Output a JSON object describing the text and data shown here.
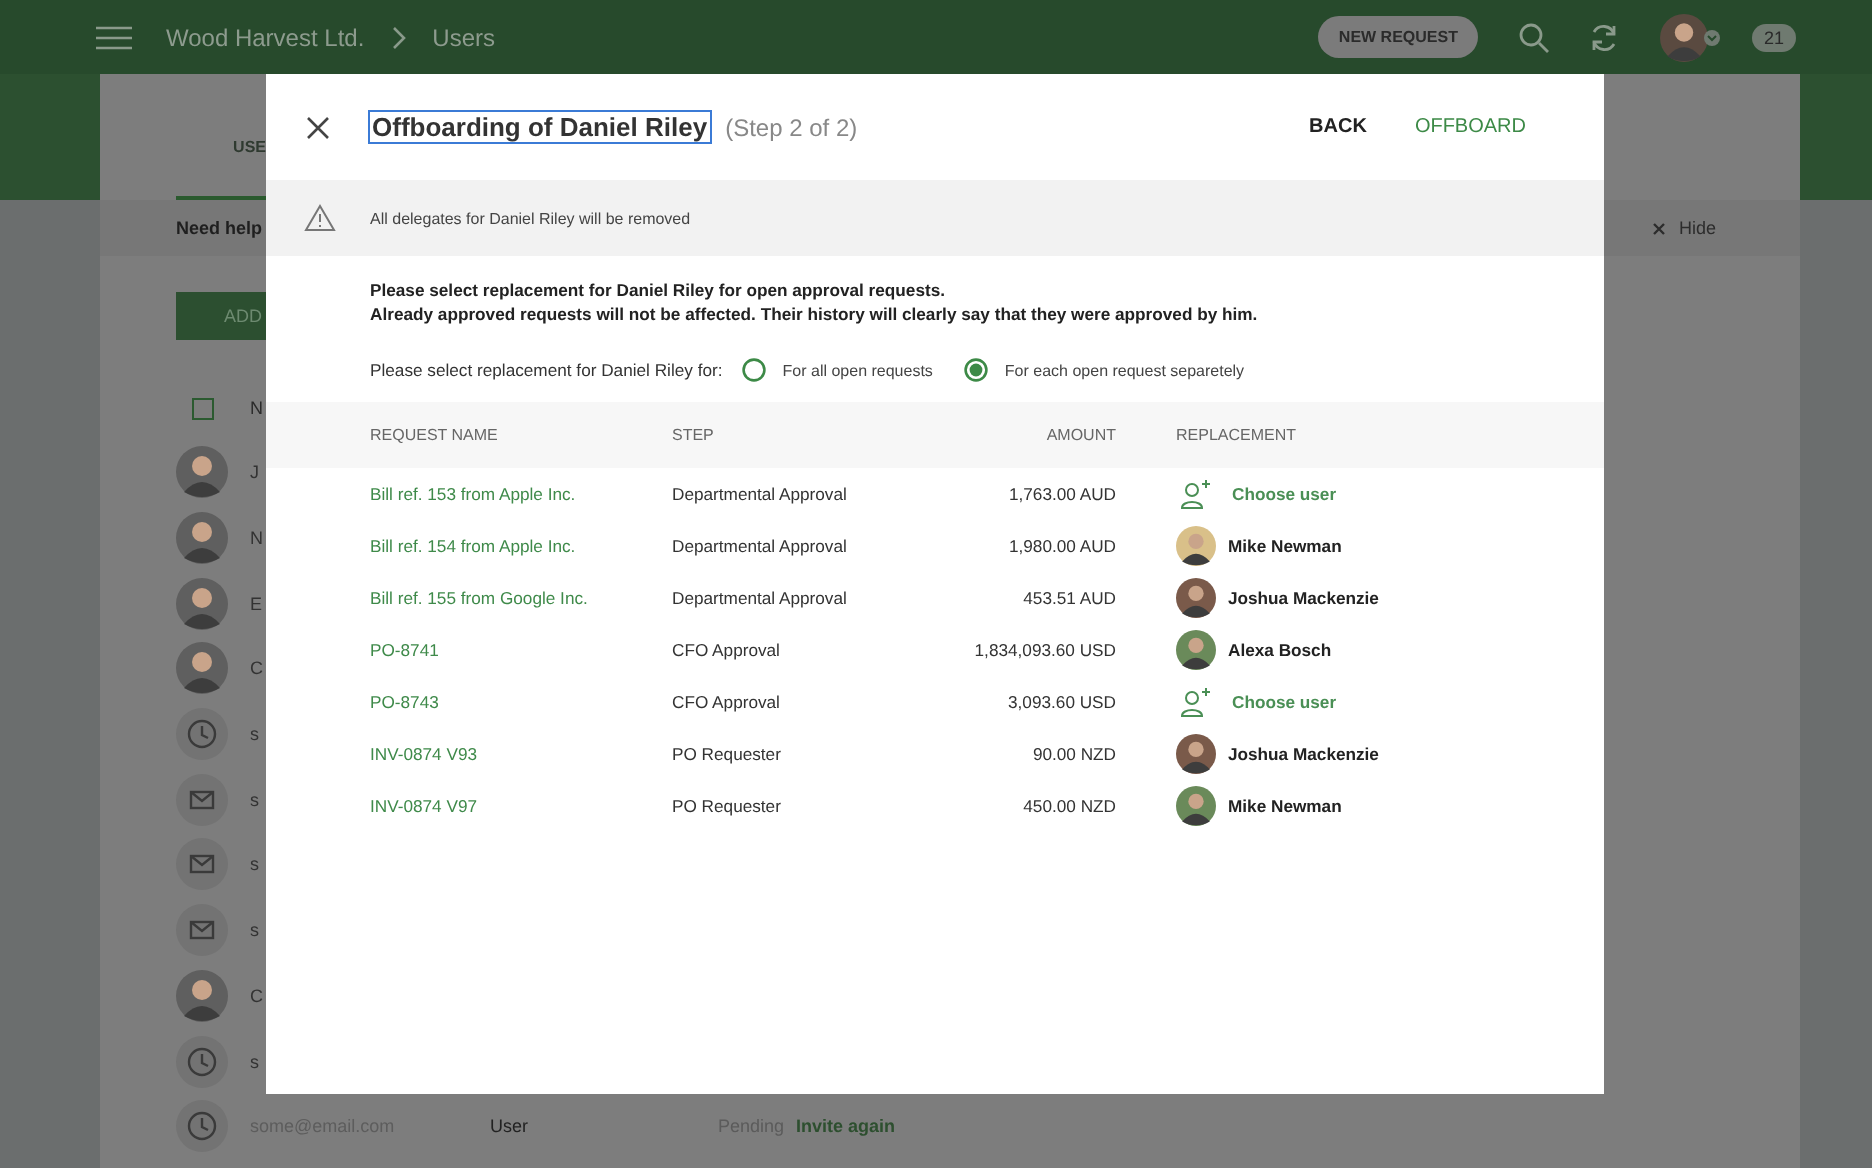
{
  "header": {
    "company": "Wood Harvest Ltd.",
    "page": "Users",
    "new_request": "NEW REQUEST",
    "notifications": "21"
  },
  "background": {
    "tabs": [
      {
        "label": "USE",
        "selected": true
      }
    ],
    "help": "Need help",
    "hide": "Hide",
    "add_button": "ADD",
    "column_header": "N",
    "header_checked": false,
    "rows": [
      {
        "kind": "avatar",
        "text": "J"
      },
      {
        "kind": "avatar",
        "text": "N"
      },
      {
        "kind": "avatar",
        "text": "E"
      },
      {
        "kind": "avatar",
        "text": "C"
      },
      {
        "kind": "clock",
        "text": "s"
      },
      {
        "kind": "mail",
        "text": "s"
      },
      {
        "kind": "mail",
        "text": "s"
      },
      {
        "kind": "mail",
        "text": "s"
      },
      {
        "kind": "avatar",
        "text": "C"
      },
      {
        "kind": "clock",
        "text": "s"
      },
      {
        "kind": "clock",
        "email": "some@email.com",
        "role": "User",
        "status": "Pending",
        "action": "Invite again"
      }
    ]
  },
  "dialog": {
    "title": "Offboarding of Daniel Riley",
    "step": "(Step 2 of 2)",
    "back": "BACK",
    "offboard": "OFFBOARD",
    "warning": "All delegates for Daniel Riley will be removed",
    "intro": [
      "Please select replacement for Daniel Riley for open approval requests.",
      "Already approved requests will not be affected. Their history will clearly say that they were approved by him."
    ],
    "choice_label": "Please select replacement for Daniel Riley for:",
    "options": [
      {
        "label": "For all open requests",
        "selected": false
      },
      {
        "label": "For each open request separetely",
        "selected": true
      }
    ],
    "columns": [
      "REQUEST NAME",
      "STEP",
      "AMOUNT",
      "REPLACEMENT"
    ],
    "rows": [
      {
        "name": "Bill ref. 153 from Apple Inc.",
        "step": "Departmental Approval",
        "amount": "1,763.00 AUD",
        "replacement": {
          "kind": "choose",
          "text": "Choose user"
        }
      },
      {
        "name": "Bill ref. 154 from Apple Inc.",
        "step": "Departmental Approval",
        "amount": "1,980.00 AUD",
        "replacement": {
          "kind": "user",
          "text": "Mike Newman"
        }
      },
      {
        "name": "Bill ref. 155 from Google Inc.",
        "step": "Departmental Approval",
        "amount": "453.51 AUD",
        "replacement": {
          "kind": "user",
          "text": "Joshua Mackenzie"
        }
      },
      {
        "name": "PO-8741",
        "step": "CFO Approval",
        "amount": "1,834,093.60 USD",
        "replacement": {
          "kind": "user",
          "text": "Alexa Bosch"
        }
      },
      {
        "name": "PO-8743",
        "step": "CFO Approval",
        "amount": "3,093.60 USD",
        "replacement": {
          "kind": "choose",
          "text": "Choose user"
        }
      },
      {
        "name": "INV-0874 V93",
        "step": "PO Requester",
        "amount": "90.00 NZD",
        "replacement": {
          "kind": "user",
          "text": "Joshua Mackenzie"
        }
      },
      {
        "name": "INV-0874 V97",
        "step": "PO Requester",
        "amount": "450.00 NZD",
        "replacement": {
          "kind": "user",
          "text": "Mike Newman"
        }
      }
    ]
  }
}
